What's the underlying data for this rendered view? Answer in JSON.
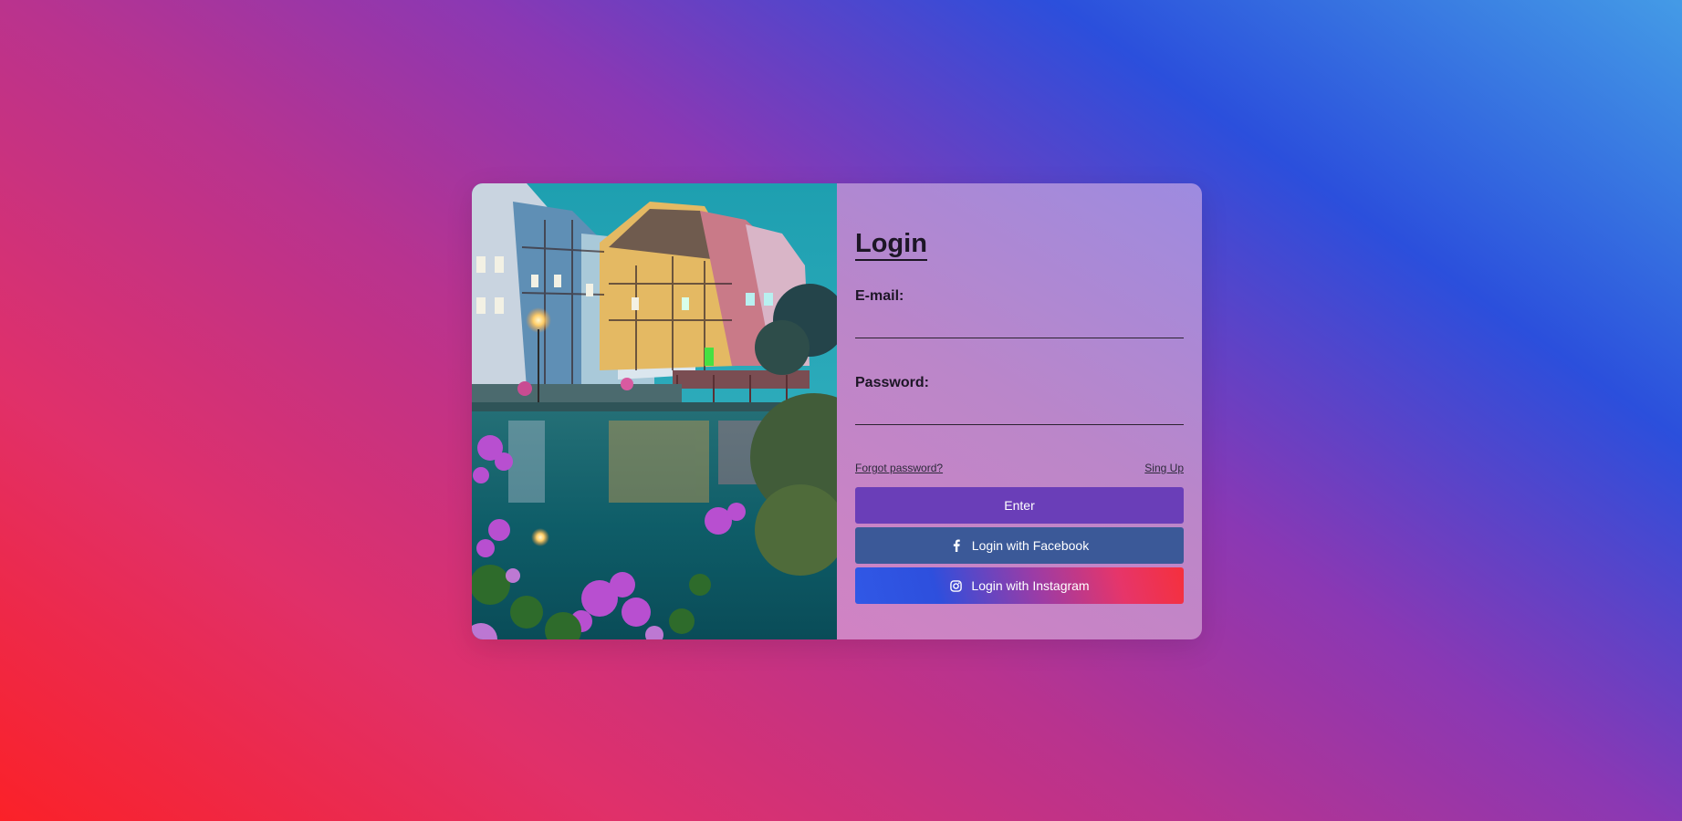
{
  "login": {
    "title": "Login",
    "email_label": "E-mail:",
    "email_value": "",
    "password_label": "Password:",
    "password_value": "",
    "forgot_link": "Forgot password?",
    "signup_link": "Sing Up",
    "enter_button": "Enter",
    "facebook_button": "Login with Facebook",
    "instagram_button": "Login with Instagram"
  },
  "icons": {
    "facebook": "facebook-icon",
    "instagram": "instagram-icon"
  },
  "colors": {
    "enter_button": "#6a3eb8",
    "facebook_button": "#3b5998",
    "text": "#1d1626"
  }
}
